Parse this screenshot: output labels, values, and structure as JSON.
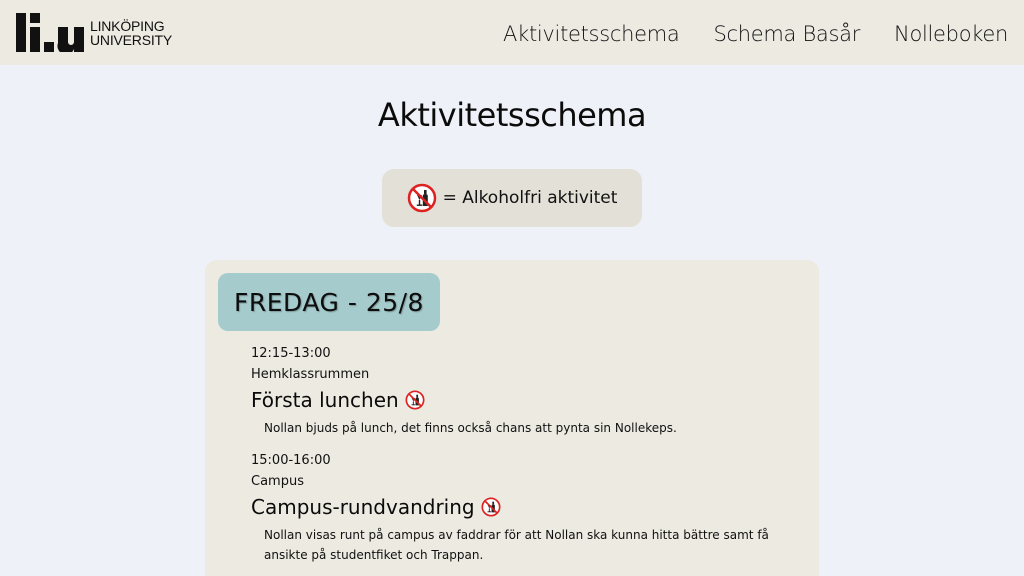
{
  "header": {
    "logo": {
      "mark": "li.u",
      "line1": "LINKÖPING",
      "line2": "UNIVERSITY"
    },
    "nav": [
      {
        "label": "Aktivitetsschema"
      },
      {
        "label": "Schema Basår"
      },
      {
        "label": "Nolleboken"
      }
    ]
  },
  "main": {
    "title": "Aktivitetsschema",
    "legend": {
      "icon": "no-alcohol-icon",
      "text": "= Alkoholfri aktivitet"
    },
    "days": [
      {
        "label": "FREDAG - 25/8",
        "events": [
          {
            "time": "12:15-13:00",
            "place": "Hemklassrummen",
            "title": "Första lunchen",
            "alcohol_free": true,
            "description": "Nollan bjuds på lunch, det finns också chans att pynta sin Nollekeps."
          },
          {
            "time": "15:00-16:00",
            "place": "Campus",
            "title": "Campus-rundvandring",
            "alcohol_free": true,
            "description": "Nollan visas runt på campus av faddrar för att Nollan ska kunna hitta bättre samt få ansikte på studentfiket och Trappan."
          }
        ]
      }
    ]
  },
  "colors": {
    "page_bg": "#eef1f7",
    "header_bg": "#edeae2",
    "card_bg": "#edeae2",
    "legend_bg": "#e3e0d7",
    "day_badge_bg": "#a6cbcd",
    "no_alcohol_red": "#d22"
  }
}
